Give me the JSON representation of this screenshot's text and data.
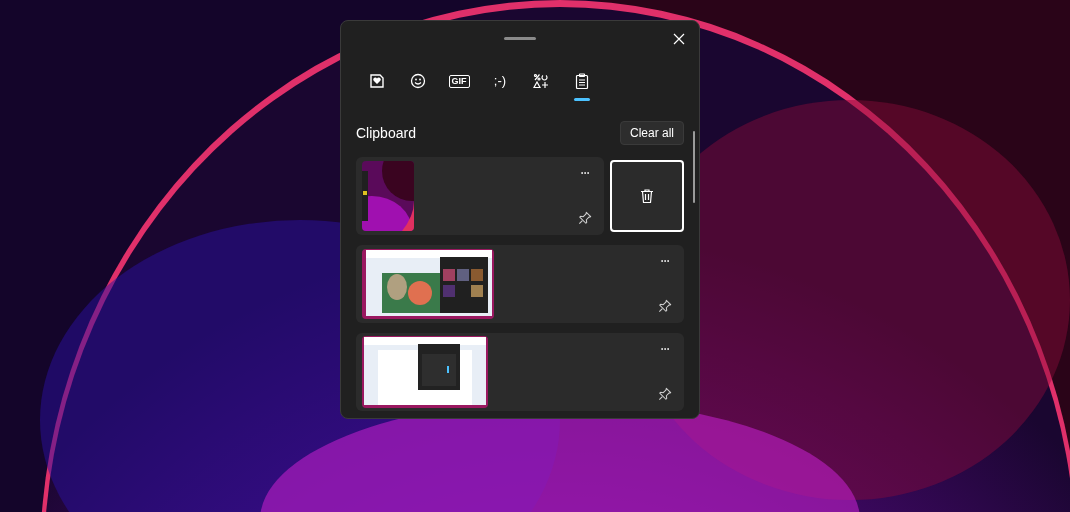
{
  "tabs": [
    {
      "kind": "stickers",
      "selected": false
    },
    {
      "kind": "emoji",
      "selected": false
    },
    {
      "kind": "gif",
      "label": "GIF",
      "selected": false
    },
    {
      "kind": "kaomoji",
      "label": ";-)",
      "selected": false
    },
    {
      "kind": "symbols",
      "selected": false
    },
    {
      "kind": "clipboard",
      "selected": true
    }
  ],
  "section": {
    "title": "Clipboard",
    "clear_button": "Clear all"
  },
  "items": [
    {
      "kind": "wallpaper",
      "more": "···",
      "delete_shown": true
    },
    {
      "kind": "document",
      "more": "···",
      "delete_shown": false
    },
    {
      "kind": "calculator",
      "more": "···",
      "delete_shown": false
    }
  ]
}
